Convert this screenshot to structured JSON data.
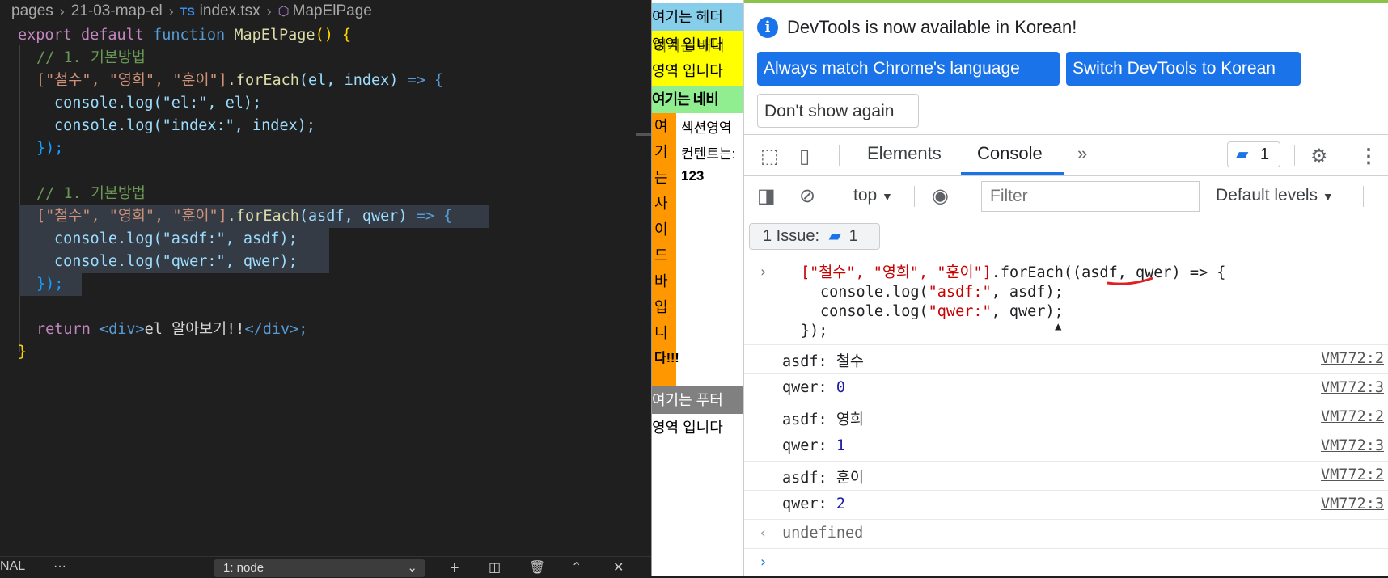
{
  "editor": {
    "breadcrumb": {
      "folder": "pages",
      "subfolder": "21-03-map-el",
      "file_badge": "TS",
      "file": "index.tsx",
      "symbol": "MapElPage"
    },
    "lines": {
      "l1": {
        "export": "export",
        "default": "default",
        "function": "function",
        "name": "MapElPage",
        "rest": "() {"
      },
      "comment1": "// 1. 기본방법",
      "comment2": "// 1. 기본방법",
      "arr1": "[\"철수\", \"영희\", \"훈이\"]",
      "forEach": ".forEach",
      "params1": "(el, index)",
      "arrow": " => {",
      "log1": "console.log(\"el:\", el);",
      "log2": "console.log(\"index:\", index);",
      "close1": "});",
      "arr2": "[\"철수\", \"영희\", \"훈이\"]",
      "params2": "(asdf, qwer)",
      "log3": "console.log(\"asdf:\", asdf);",
      "log4": "console.log(\"qwer:\", qwer);",
      "close2": "});",
      "ret_kw": "return",
      "ret_open": "<div>",
      "ret_text": "el 알아보기!!",
      "ret_close": "</div>;",
      "end": "}"
    },
    "terminal": {
      "tab_label": "NAL",
      "more": "···",
      "shell": "1: node",
      "icons": [
        "add-icon",
        "split-icon",
        "trash-icon",
        "chevron-up-icon",
        "close-icon"
      ]
    }
  },
  "preview": {
    "header": "여기는 헤더",
    "banner_line1": "영역 입니다",
    "banner_overlap": "여기는 배너",
    "banner_line2": "영역 입니다",
    "nav": "여기는 네비",
    "sidebar_chars": [
      "여",
      "기",
      "는",
      "사",
      "이",
      "드",
      "바",
      "입",
      "니",
      "다!!!"
    ],
    "body_text1": "섹션영역",
    "body_text2": "컨텐트는:",
    "body_text3": "123",
    "footer": "여기는 푸터",
    "footer_line2": "영역 입니다"
  },
  "devtools": {
    "infobar": {
      "message": "DevTools is now available in Korean!",
      "btn_match": "Always match Chrome's language",
      "btn_switch": "Switch DevTools to Korean",
      "btn_dismiss": "Don't show again"
    },
    "tabs": {
      "elements": "Elements",
      "console": "Console",
      "more": "»"
    },
    "issues_count": "1",
    "filterbar": {
      "context": "top",
      "filter_placeholder": "Filter",
      "levels": "Default levels"
    },
    "issue_chip": {
      "label": "1 Issue:",
      "count": "1"
    },
    "console": {
      "input_lines": {
        "arr": "[\"철수\", \"영희\", \"훈이\"]",
        "rest1": ".forEach((asdf, qwer) => {",
        "log_a_pre": "console.log(",
        "log_a_str": "\"asdf:\"",
        "log_a_post": ", asdf);",
        "log_b_pre": "console.log(",
        "log_b_str": "\"qwer:\"",
        "log_b_post": ", qwer);",
        "close": "});"
      },
      "logs": [
        {
          "label": "asdf:",
          "value": "철수",
          "source": "VM772:2"
        },
        {
          "label": "qwer:",
          "value": "0",
          "source": "VM772:3"
        },
        {
          "label": "asdf:",
          "value": "영희",
          "source": "VM772:2"
        },
        {
          "label": "qwer:",
          "value": "1",
          "source": "VM772:3"
        },
        {
          "label": "asdf:",
          "value": "훈이",
          "source": "VM772:2"
        },
        {
          "label": "qwer:",
          "value": "2",
          "source": "VM772:3"
        }
      ],
      "result": "undefined"
    }
  }
}
